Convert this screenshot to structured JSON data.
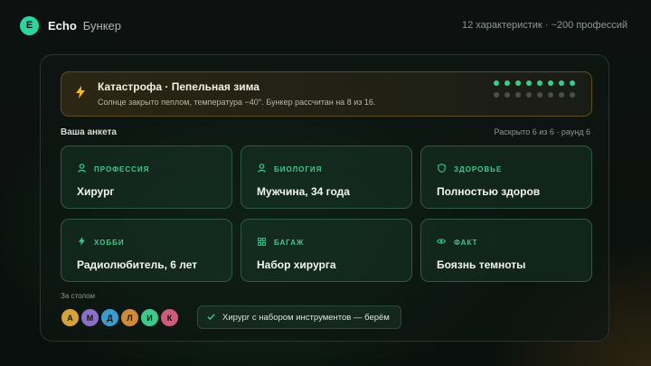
{
  "header": {
    "logo_letter": "E",
    "app_name": "Echo",
    "app_sub": "Бункер",
    "stats": "12 характеристик · ~200 профессий"
  },
  "disaster": {
    "icon": "bolt-icon",
    "title": "Катастрофа · Пепельная зима",
    "description": "Солнце закрыто пеплом, температура −40°. Бункер рассчитан на 8 из 16.",
    "capacity": 8,
    "total": 16,
    "colors": {
      "filled": "#36cf8c",
      "empty": "#48504b",
      "accent": "#f5b72e"
    }
  },
  "profile": {
    "title": "Ваша анкета",
    "meta": "Раскрыто 6 из 6 · раунд 6",
    "cards": [
      {
        "icon": "person-icon",
        "label": "ПРОФЕССИЯ",
        "value": "Хирург"
      },
      {
        "icon": "person-icon",
        "label": "БИОЛОГИЯ",
        "value": "Мужчина, 34 года"
      },
      {
        "icon": "shield-icon",
        "label": "ЗДОРОВЬЕ",
        "value": "Полностью здоров"
      },
      {
        "icon": "bolt-icon",
        "label": "ХОББИ",
        "value": "Радиолюбитель, 6 лет"
      },
      {
        "icon": "grid-icon",
        "label": "БАГАЖ",
        "value": "Набор хирурга"
      },
      {
        "icon": "eye-icon",
        "label": "ФАКТ",
        "value": "Боязнь темноты"
      }
    ]
  },
  "table": {
    "label": "За столом",
    "players": [
      {
        "letter": "А",
        "color": "#d4a33b"
      },
      {
        "letter": "М",
        "color": "#8a6fc9"
      },
      {
        "letter": "Д",
        "color": "#3e9bd0"
      },
      {
        "letter": "Л",
        "color": "#d08a3e"
      },
      {
        "letter": "И",
        "color": "#3ec98a"
      },
      {
        "letter": "К",
        "color": "#d05a7a"
      }
    ]
  },
  "verdict": {
    "icon": "check-icon",
    "text": "Хирург с набором инструментов — берём"
  }
}
